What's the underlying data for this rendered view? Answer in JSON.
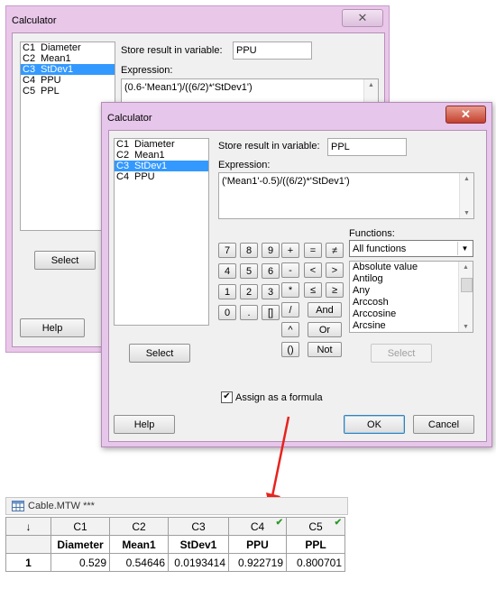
{
  "back_dialog": {
    "title": "Calculator",
    "close_glyph": "✕",
    "columns": [
      {
        "id": "C1",
        "name": "Diameter",
        "selected": false
      },
      {
        "id": "C2",
        "name": "Mean1",
        "selected": false
      },
      {
        "id": "C3",
        "name": "StDev1",
        "selected": true
      },
      {
        "id": "C4",
        "name": "PPU",
        "selected": false
      },
      {
        "id": "C5",
        "name": "PPL",
        "selected": false
      }
    ],
    "store_label": "Store result in variable:",
    "store_value": "PPU",
    "expression_label": "Expression:",
    "expression_value": "(0.6-'Mean1')/((6/2)*'StDev1')",
    "select_label": "Select",
    "help_label": "Help"
  },
  "front_dialog": {
    "title": "Calculator",
    "close_glyph": "✕",
    "columns": [
      {
        "id": "C1",
        "name": "Diameter",
        "selected": false
      },
      {
        "id": "C2",
        "name": "Mean1",
        "selected": false
      },
      {
        "id": "C3",
        "name": "StDev1",
        "selected": true
      },
      {
        "id": "C4",
        "name": "PPU",
        "selected": false
      }
    ],
    "store_label": "Store result in variable:",
    "store_value": "PPL",
    "expression_label": "Expression:",
    "expression_value": "('Mean1'-0.5)/((6/2)*'StDev1')",
    "keypad": {
      "digits": [
        "7",
        "8",
        "9",
        "4",
        "5",
        "6",
        "1",
        "2",
        "3",
        "0",
        ".",
        "[]"
      ],
      "operators": [
        "+",
        "-",
        "*",
        "/",
        "^",
        "()"
      ],
      "comparisons": [
        "=",
        "≠",
        "<",
        ">",
        "≤",
        "≥"
      ],
      "logic": [
        "And",
        "Or",
        "Not"
      ]
    },
    "functions_label": "Functions:",
    "functions_filter": "All functions",
    "functions": [
      "Absolute value",
      "Antilog",
      "Any",
      "Arccosh",
      "Arccosine",
      "Arcsine"
    ],
    "select_label": "Select",
    "functions_select_label": "Select",
    "assign_formula_label": "Assign as a formula",
    "assign_formula_checked": true,
    "check_glyph": "✔",
    "help_label": "Help",
    "ok_label": "OK",
    "cancel_label": "Cancel"
  },
  "worksheet": {
    "title": "Cable.MTW ***",
    "sort_glyph": "↓",
    "column_ids": [
      "C1",
      "C2",
      "C3",
      "C4",
      "C5"
    ],
    "formula_marks": [
      false,
      false,
      false,
      true,
      true
    ],
    "check_glyph": "✔",
    "column_names": [
      "Diameter",
      "Mean1",
      "StDev1",
      "PPU",
      "PPL"
    ],
    "rows": [
      {
        "index": "1",
        "cells": [
          "0.529",
          "0.54646",
          "0.0193414",
          "0.922719",
          "0.800701"
        ]
      }
    ]
  },
  "colors": {
    "selection": "#3399ff",
    "arrow": "#e8221c",
    "dialog_frame": "#e6c6ea",
    "formula_check": "#2a9a2a"
  }
}
